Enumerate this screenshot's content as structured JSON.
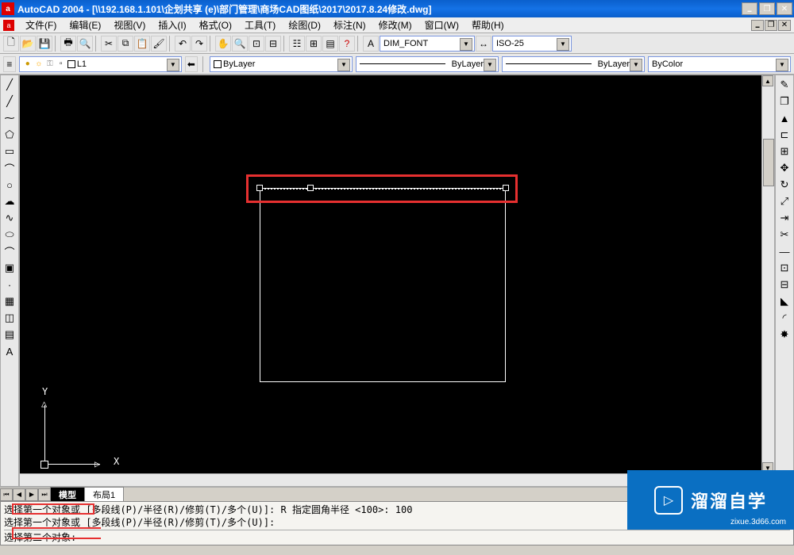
{
  "title": "AutoCAD 2004 - [\\\\192.168.1.101\\企划共享 (e)\\部门管理\\商场CAD图纸\\2017\\2017.8.24修改.dwg]",
  "menu": [
    "文件(F)",
    "编辑(E)",
    "视图(V)",
    "插入(I)",
    "格式(O)",
    "工具(T)",
    "绘图(D)",
    "标注(N)",
    "修改(M)",
    "窗口(W)",
    "帮助(H)"
  ],
  "style_combo1": "DIM_FONT",
  "style_combo2": "ISO-25",
  "layer": {
    "name": "L1",
    "bylayer": "ByLayer",
    "color": "ByColor"
  },
  "tabs": {
    "model": "模型",
    "layout1": "布局1"
  },
  "ucs": {
    "x": "X",
    "y": "Y"
  },
  "cmd": {
    "l1": "选择第一个对象或 [多段线(P)/半径(R)/修剪(T)/多个(U)]: R 指定圆角半径 <100>: 100",
    "l2": "选择第一个对象或 [多段线(P)/半径(R)/修剪(T)/多个(U)]:",
    "l3": "选择第二个对象:"
  },
  "watermark": {
    "zh": "溜溜自学",
    "url": "zixue.3d66.com"
  },
  "top_icons": [
    "new",
    "open",
    "save",
    "print",
    "print-preview",
    "cut",
    "copy",
    "paste",
    "match",
    "undo",
    "redo",
    "pan",
    "zoom",
    "zoom-window",
    "zoom-prev",
    "properties",
    "design-center",
    "tool-palettes",
    "help",
    "close"
  ],
  "draw_icons": [
    "line",
    "xline",
    "polyline",
    "polygon",
    "rectangle",
    "arc",
    "circle",
    "revcloud",
    "spline",
    "ellipse",
    "ellipse-arc",
    "block",
    "point",
    "hatch",
    "region",
    "table",
    "text"
  ],
  "modify_icons": [
    "erase",
    "copy",
    "mirror",
    "offset",
    "array",
    "move",
    "rotate",
    "scale",
    "stretch",
    "trim",
    "extend",
    "break",
    "break2",
    "chamfer",
    "fillet",
    "explode"
  ]
}
